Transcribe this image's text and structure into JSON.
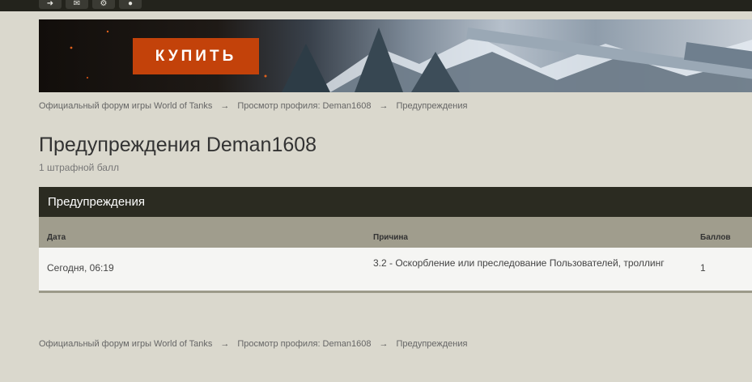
{
  "topbar": {
    "icons": [
      "sign-in-icon",
      "mail-icon",
      "settings-icon",
      "user-icon"
    ]
  },
  "banner": {
    "buy_label": "КУПИТЬ",
    "accent_color": "#c3420a"
  },
  "breadcrumb": {
    "items": [
      "Официальный форум игры World of Tanks",
      "Просмотр профиля: Deman1608",
      "Предупреждения"
    ],
    "separator": "→"
  },
  "page": {
    "title": "Предупреждения Deman1608",
    "subtitle": "1 штрафной балл"
  },
  "panel": {
    "title": "Предупреждения",
    "columns": {
      "date": "Дата",
      "reason": "Причина",
      "points": "Баллов"
    },
    "rows": [
      {
        "date": "Сегодня, 06:19",
        "reason": "3.2 - Оскорбление или преследование Пользователей, троллинг",
        "points": "1"
      }
    ]
  }
}
